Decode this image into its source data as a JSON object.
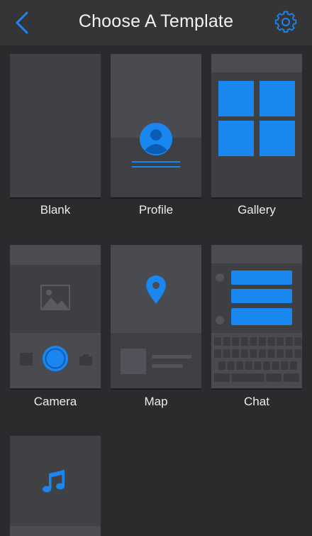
{
  "header": {
    "title": "Choose A Template",
    "back_icon": "chevron-left-icon",
    "settings_icon": "gear-icon"
  },
  "templates": [
    {
      "label": "Blank"
    },
    {
      "label": "Profile"
    },
    {
      "label": "Gallery"
    },
    {
      "label": "Camera"
    },
    {
      "label": "Map"
    },
    {
      "label": "Chat"
    },
    {
      "label": ""
    }
  ],
  "colors": {
    "accent": "#1a86f0",
    "background": "#2b2b2d",
    "navbar": "#353538",
    "tile": "#3e3f43"
  }
}
